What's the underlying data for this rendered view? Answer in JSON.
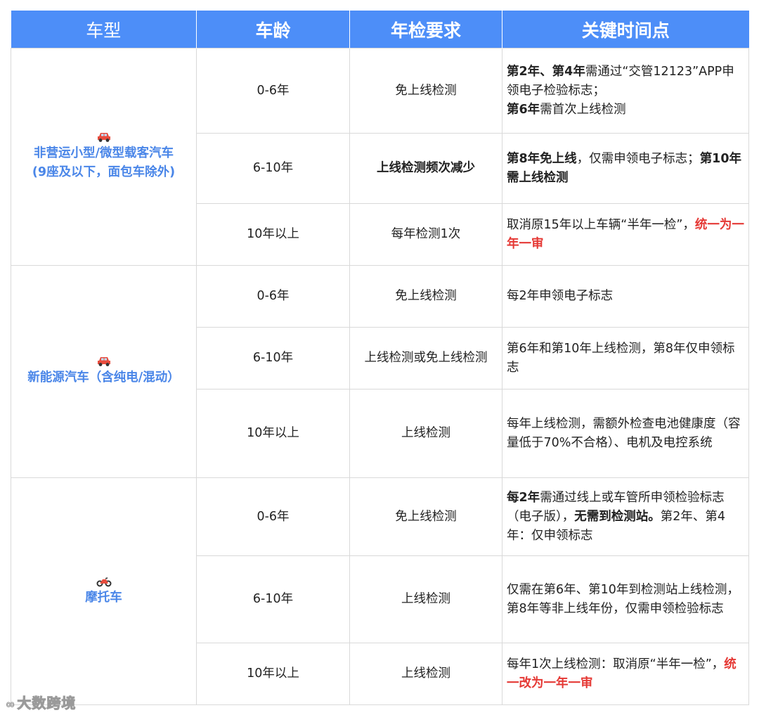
{
  "headers": [
    "车型",
    "车龄",
    "年检要求",
    "关键时间点"
  ],
  "colors": {
    "header_bg": "#4d8ef8",
    "type_text": "#4a86e8",
    "highlight_red": "#e53935",
    "border": "#d9d9d9"
  },
  "groups": [
    {
      "icon": "car-icon",
      "type_line1": "非营运小型/微型载客汽车",
      "type_line2": "(9座及以下，面包车除外)",
      "rows": [
        {
          "age": "0-6年",
          "req": "免上线检测",
          "key": {
            "p1": "第2年、第4年",
            "p2": "需通过“交管12123”APP申领电子检验标志；",
            "p3": "第6年",
            "p4": "需首次上线检测"
          }
        },
        {
          "age": "6-10年",
          "req": "上线检测频次减少",
          "key": {
            "p1": "第8年免上线",
            "p2": "，仅需申领电子标志；",
            "p3": "第10年需上线检测"
          }
        },
        {
          "age": "10年以上",
          "req": "每年检测1次",
          "key": {
            "p1": "取消原15年以上车辆“半年一检”，",
            "p2": "统一为一年一审"
          }
        }
      ]
    },
    {
      "icon": "car-icon",
      "type_line1": "新能源汽车（含纯电/混动）",
      "rows": [
        {
          "age": "0-6年",
          "req": "免上线检测",
          "key": {
            "p1": "每2年申领电子标志"
          }
        },
        {
          "age": "6-10年",
          "req": "上线检测或免上线检测",
          "key": {
            "p1": "第6年和第10年上线检测，第8年仅申领标志"
          }
        },
        {
          "age": "10年以上",
          "req": "上线检测",
          "key": {
            "p1": "每年上线检测，需额外检查电池健康度（容量低于70%不合格）、电机及电控系统"
          }
        }
      ]
    },
    {
      "icon": "motorcycle-icon",
      "type_line1": "摩托车",
      "rows": [
        {
          "age": "0-6年",
          "req": "免上线检测",
          "key": {
            "p1": "每2年",
            "p2": "需通过线上或车管所申领检验标志（电子版），",
            "p3": "无需到检测站。",
            "p4": "第2年、第4年：仅申领标志"
          }
        },
        {
          "age": "6-10年",
          "req": "上线检测",
          "key": {
            "p1": "仅需在第6年、第10年到检测站上线检测，第8年等非上线年份，仅需申领检验标志"
          }
        },
        {
          "age": "10年以上",
          "req": "上线检测",
          "key": {
            "p1": "每年1次上线检测：取消原“半年一检”，",
            "p2": "统一改为一年一审"
          }
        }
      ]
    }
  ],
  "watermark": "大数跨境"
}
